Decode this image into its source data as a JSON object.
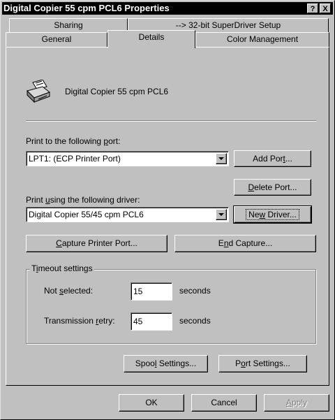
{
  "window": {
    "title": "Digital Copier 55 cpm PCL6 Properties",
    "help_label": "?",
    "close_label": "X"
  },
  "tabs": {
    "row1": [
      "Sharing",
      "--> 32-bit SuperDriver Setup"
    ],
    "row2": [
      "General",
      "Details",
      "Color Management"
    ],
    "active": "Details"
  },
  "printer": {
    "name": "Digital Copier 55 cpm PCL6",
    "icon": "printer-icon"
  },
  "port": {
    "label_pre": "Print to the following ",
    "label_key": "p",
    "label_post": "ort:",
    "value": "LPT1:  (ECP Printer Port)",
    "add_pre": "Add Por",
    "add_key": "t",
    "add_post": "...",
    "delete_pre": "",
    "delete_key": "D",
    "delete_post": "elete Port..."
  },
  "driver": {
    "label_pre": "Print ",
    "label_key": "u",
    "label_post": "sing the following driver:",
    "value": "Digital Copier 55/45 cpm PCL6",
    "new_pre": "Ne",
    "new_key": "w",
    "new_post": " Driver..."
  },
  "capture": {
    "capture_pre": "",
    "capture_key": "C",
    "capture_post": "apture Printer Port...",
    "end_pre": "E",
    "end_key": "n",
    "end_post": "d Capture..."
  },
  "timeout": {
    "title_pre": "T",
    "title_key": "i",
    "title_post": "meout settings",
    "not_selected_pre": "Not ",
    "not_selected_key": "s",
    "not_selected_post": "elected:",
    "not_selected_value": "15",
    "retry_pre": "Transmission ",
    "retry_key": "r",
    "retry_post": "etry:",
    "retry_value": "45",
    "unit": "seconds"
  },
  "settings": {
    "spool_pre": "Spoo",
    "spool_key": "l",
    "spool_post": " Settings...",
    "port_pre": "P",
    "port_key": "o",
    "port_post": "rt Settings..."
  },
  "footer": {
    "ok": "OK",
    "cancel": "Cancel",
    "apply_pre": "",
    "apply_key": "A",
    "apply_post": "pply"
  }
}
